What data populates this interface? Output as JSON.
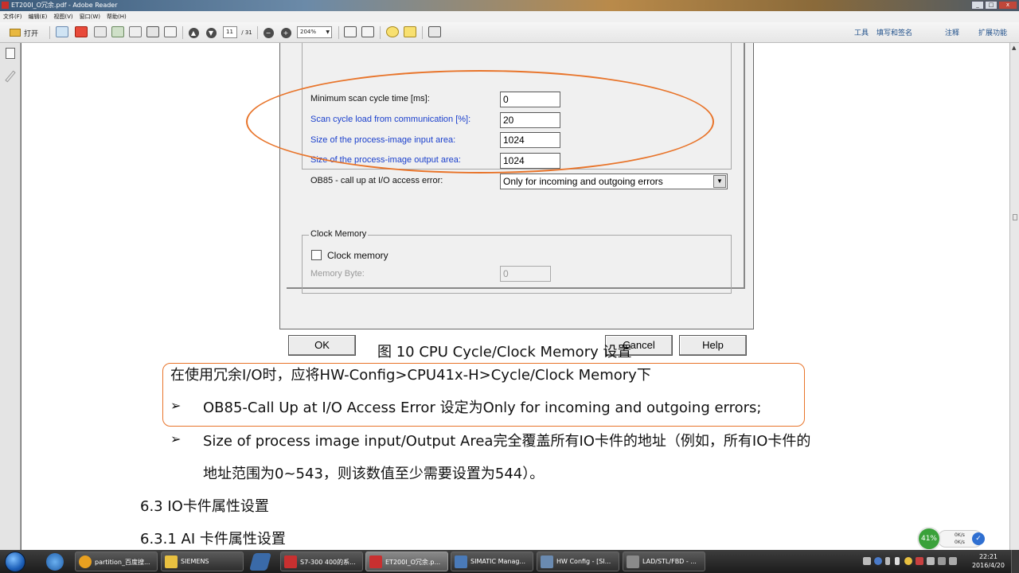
{
  "window": {
    "title": "ET200I_O冗余.pdf - Adobe Reader",
    "buttons": [
      "_",
      "□",
      "x"
    ]
  },
  "menu": [
    "文件(F)",
    "编辑(E)",
    "视图(V)",
    "窗口(W)",
    "帮助(H)"
  ],
  "toolbar": {
    "open_label": "打开",
    "page_current": "11",
    "page_total": "/ 31",
    "zoom": "204%",
    "right_items": [
      "工具",
      "填写和签名",
      "注释",
      "扩展功能"
    ]
  },
  "dialog": {
    "fields": [
      {
        "label": "Minimum scan cycle time [ms]:",
        "value": "0",
        "style": "normal"
      },
      {
        "label": "Scan cycle load from communication [%]:",
        "value": "20",
        "style": "blue"
      },
      {
        "label": "Size of the process-image input area:",
        "value": "1024",
        "style": "blue"
      },
      {
        "label": "Size of the process-image output area:",
        "value": "1024",
        "style": "blue"
      }
    ],
    "ob85": {
      "label": "OB85 - call up at I/O access error:",
      "value": "Only for incoming and outgoing errors"
    },
    "clock_group_title": "Clock Memory",
    "clock_checkbox_label": "Clock memory",
    "memory_byte_label": "Memory Byte:",
    "memory_byte_value": "0",
    "ok_label": "OK",
    "cancel_label": "Cancel",
    "help_label": "Help"
  },
  "document": {
    "caption": "图 10  CPU Cycle/Clock Memory 设置",
    "intro": "在使用冗余I/O时，应将HW-Config>CPU41x-H>Cycle/Clock Memory下",
    "bullets": [
      "OB85-Call Up at I/O Access Error 设定为Only for incoming and outgoing errors;",
      "Size of process image input/Output Area完全覆盖所有IO卡件的地址（例如，所有IO卡件的"
    ],
    "bullet_cont": "地址范围为0~543，则该数值至少需要设置为544）。",
    "heading1": "6.3 IO卡件属性设置",
    "heading2": "6.3.1 AI 卡件属性设置"
  },
  "network_widget": {
    "percent": "41%",
    "up": "0K/s",
    "down": "0K/s"
  },
  "taskbar": {
    "items": [
      {
        "label": "partition_百度搜...",
        "color": "#e8a020"
      },
      {
        "label": "SIEMENS",
        "color": "#e8c040"
      },
      {
        "label": "S7-300 400的系...",
        "color": "#c83030"
      },
      {
        "label": "ET200I_O冗余.p...",
        "color": "#c83030"
      },
      {
        "label": "SIMATIC Manag...",
        "color": "#4a7ab8"
      },
      {
        "label": "HW Config - [SI...",
        "color": "#6a8ab0"
      },
      {
        "label": "LAD/STL/FBD  - ...",
        "color": "#8a8a8a"
      }
    ],
    "time": "22:21",
    "date": "2016/4/20"
  }
}
